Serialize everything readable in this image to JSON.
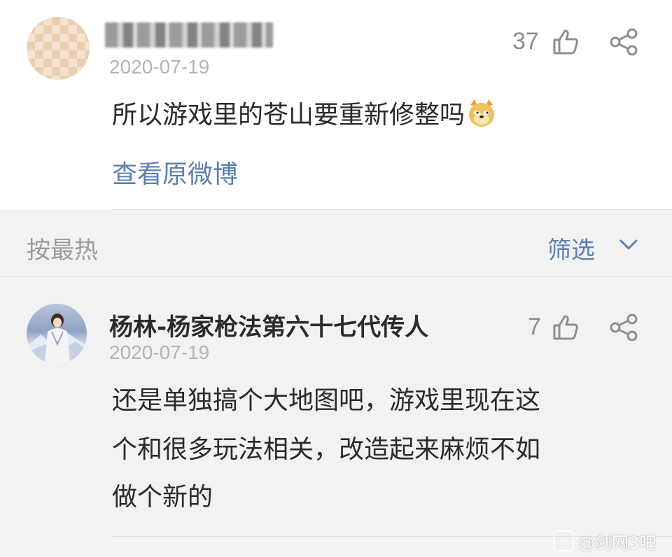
{
  "post": {
    "like_count": "37",
    "date": "2020-07-19",
    "text": "所以游戏里的苍山要重新修整吗",
    "emoji": "doge-emoji",
    "view_original_link": "查看原微博"
  },
  "sort_bar": {
    "sort_label": "按最热",
    "filter_label": "筛选"
  },
  "comment": {
    "username": "杨林-杨家枪法第六十七代传人",
    "like_count": "7",
    "date": "2020-07-19",
    "text_lines": [
      "还是单独搞个大地图吧，游戏里现在这",
      "个和很多玩法相关，改造起来麻烦不如",
      "做个新的"
    ]
  },
  "watermark": {
    "text": "@剑网3吧"
  },
  "colors": {
    "link": "#5b7fb1",
    "meta": "#b4b4b4",
    "background": "#f2f2f2"
  }
}
